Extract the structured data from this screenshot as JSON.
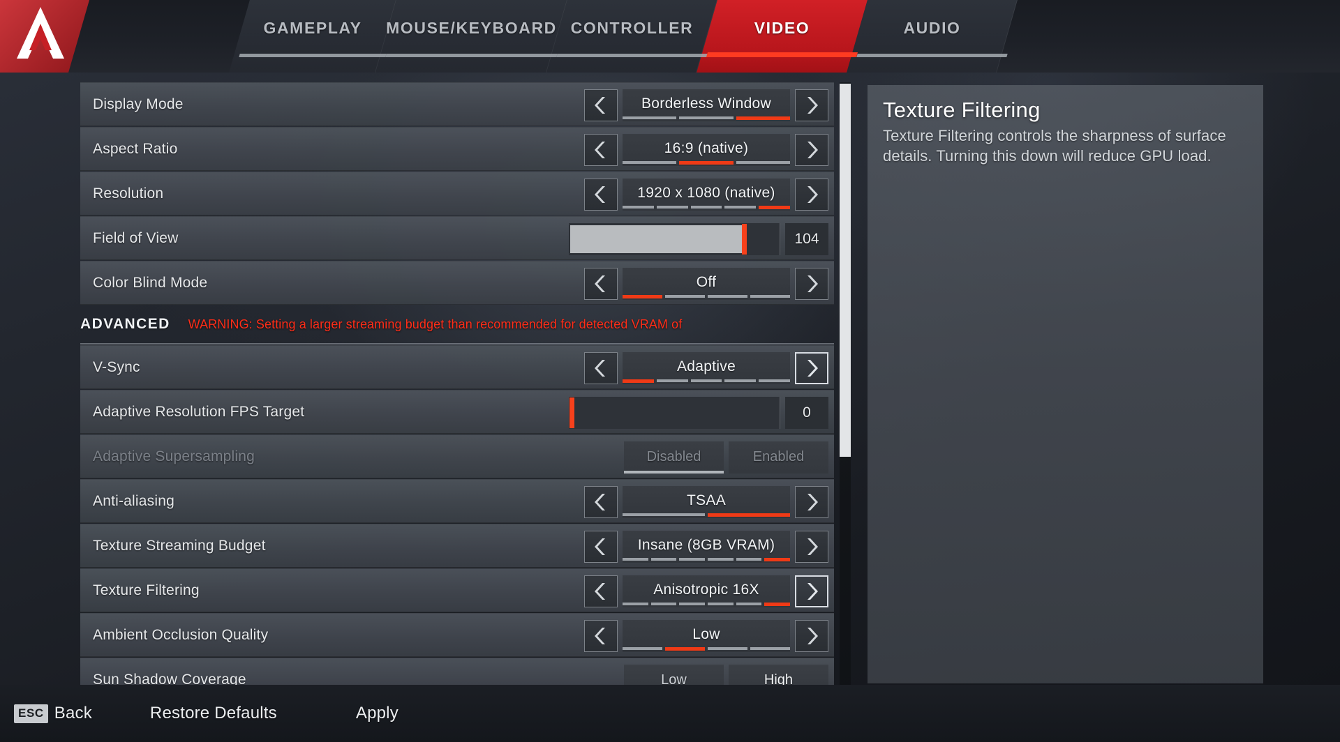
{
  "app": {
    "logo_icon": "apex-legends-logo-icon",
    "accent_red": "#ff3b21",
    "tab_active_bg": "#c51f25"
  },
  "tabs": [
    {
      "id": "gameplay",
      "label": "GAMEPLAY",
      "active": false
    },
    {
      "id": "mouse-keyboard",
      "label": "MOUSE/KEYBOARD",
      "active": false
    },
    {
      "id": "controller",
      "label": "CONTROLLER",
      "active": false
    },
    {
      "id": "video",
      "label": "VIDEO",
      "active": true
    },
    {
      "id": "audio",
      "label": "AUDIO",
      "active": false
    }
  ],
  "settings": {
    "display_mode": {
      "label": "Display Mode",
      "value": "Borderless Window",
      "segments": 3,
      "active_segment": 3
    },
    "aspect_ratio": {
      "label": "Aspect Ratio",
      "value": "16:9 (native)",
      "segments": 3,
      "active_segment": 2
    },
    "resolution": {
      "label": "Resolution",
      "value": "1920 x 1080 (native)",
      "segments": 5,
      "active_segment": 5
    },
    "field_of_view": {
      "label": "Field of View",
      "value": "104",
      "fill_percent": 82
    },
    "color_blind": {
      "label": "Color Blind Mode",
      "value": "Off",
      "segments": 4,
      "active_segment": 1
    },
    "vsync": {
      "label": "V-Sync",
      "value": "Adaptive",
      "segments": 5,
      "active_segment": 1
    },
    "adaptive_fps": {
      "label": "Adaptive Resolution FPS Target",
      "value": "0",
      "fill_percent": 0
    },
    "adaptive_ss": {
      "label": "Adaptive Supersampling",
      "option_off": "Disabled",
      "option_on": "Enabled",
      "selected": "Disabled",
      "disabled": true
    },
    "anti_aliasing": {
      "label": "Anti-aliasing",
      "value": "TSAA",
      "segments": 2,
      "active_segment": 2
    },
    "texture_budget": {
      "label": "Texture Streaming Budget",
      "value": "Insane (8GB VRAM)",
      "segments": 6,
      "active_segment": 6
    },
    "texture_filter": {
      "label": "Texture Filtering",
      "value": "Anisotropic 16X",
      "segments": 6,
      "active_segment": 6
    },
    "ambient_occ": {
      "label": "Ambient Occlusion Quality",
      "value": "Low",
      "segments": 4,
      "active_segment": 2
    },
    "sun_shadow": {
      "label": "Sun Shadow Coverage",
      "option_off": "Low",
      "option_on": "High",
      "selected": "High"
    }
  },
  "advanced": {
    "title": "ADVANCED",
    "warning": "WARNING: Setting a larger streaming budget than recommended for detected VRAM of"
  },
  "info_panel": {
    "title": "Texture Filtering",
    "description": "Texture Filtering controls the sharpness of surface details. Turning this down will reduce GPU load."
  },
  "footer": {
    "back_key": "ESC",
    "back_label": "Back",
    "restore_label": "Restore Defaults",
    "apply_label": "Apply"
  }
}
